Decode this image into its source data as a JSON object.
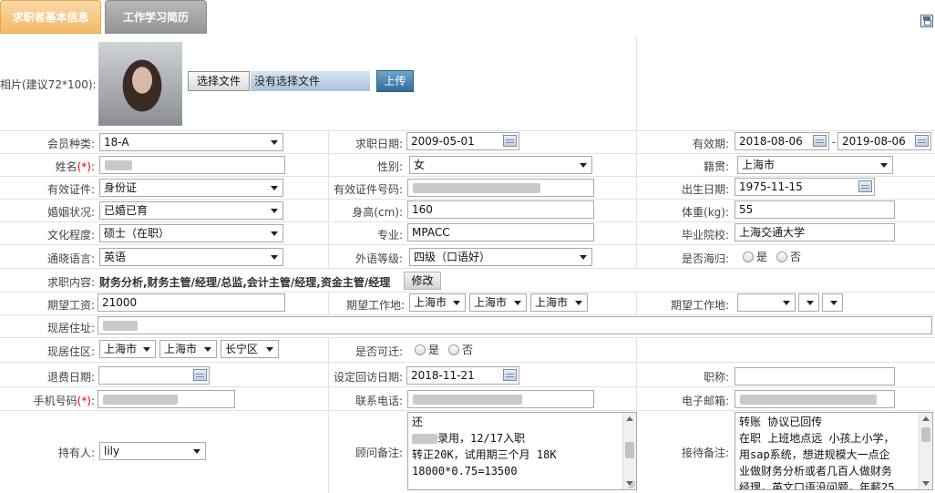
{
  "tabs": [
    {
      "label": "求职者基本信息",
      "active": true
    },
    {
      "label": "工作学习简历",
      "active": false
    }
  ],
  "photo": {
    "label": "相片(建议72*100):",
    "choose_file": "选择文件",
    "no_file": "没有选择文件",
    "upload": "上传"
  },
  "member_type": {
    "label": "会员种类:",
    "value": "18-A"
  },
  "apply_date": {
    "label": "求职日期:",
    "value": "2009-05-01"
  },
  "valid_period": {
    "label": "有效期:",
    "from": "2018-08-06",
    "sep": "-",
    "to": "2019-08-06"
  },
  "name": {
    "label": "姓名",
    "req": "(*)",
    "colon": ":"
  },
  "gender": {
    "label": "性别:",
    "value": "女"
  },
  "native": {
    "label": "籍贯:",
    "value": "上海市"
  },
  "id_type": {
    "label": "有效证件:",
    "value": "身份证"
  },
  "id_number": {
    "label": "有效证件号码:"
  },
  "birth": {
    "label": "出生日期:",
    "value": "1975-11-15"
  },
  "marital": {
    "label": "婚姻状况:",
    "value": "已婚已育"
  },
  "height": {
    "label": "身高(cm):",
    "value": "160"
  },
  "weight": {
    "label": "体重(kg):",
    "value": "55"
  },
  "education": {
    "label": "文化程度:",
    "value": "硕士（在职）"
  },
  "major": {
    "label": "专业:",
    "value": "MPACC"
  },
  "school": {
    "label": "毕业院校:",
    "value": "上海交通大学"
  },
  "language": {
    "label": "通晓语言:",
    "value": "英语"
  },
  "lang_level": {
    "label": "外语等级:",
    "value": "四级（口语好）"
  },
  "returnee": {
    "label": "是否海归:",
    "yes": "是",
    "no": "否"
  },
  "job_content": {
    "label": "求职内容:",
    "value": "财务分析,财务主管/经理/总监,会计主管/经理,资金主管/经理",
    "edit": "修改"
  },
  "salary": {
    "label": "期望工资:",
    "value": "21000"
  },
  "work_place": {
    "label": "期望工作地:",
    "values": [
      "上海市",
      "上海市",
      "上海市"
    ]
  },
  "work_place2": {
    "label": "期望工作地:"
  },
  "address": {
    "label": "现居住址:"
  },
  "residence": {
    "label": "现居住区:",
    "values": [
      "上海市",
      "上海市",
      "长宁区"
    ]
  },
  "relocate": {
    "label": "是否可迁:",
    "yes": "是",
    "no": "否"
  },
  "refund_date": {
    "label": "退费日期:"
  },
  "visit_date": {
    "label": "设定回访日期:",
    "value": "2018-11-21"
  },
  "title": {
    "label": "职称:"
  },
  "mobile": {
    "label": "手机号码",
    "req": "(*)",
    "colon": ":"
  },
  "phone": {
    "label": "联系电话:"
  },
  "email": {
    "label": "电子邮箱:"
  },
  "owner": {
    "label": "持有人:",
    "value": "lily"
  },
  "consultant_note": {
    "label": "顾问备注:",
    "lines": [
      "还",
      "录用，12/17入职",
      "转正20K，试用期三个月 18K",
      "18000*0.75=13500"
    ]
  },
  "reception_note": {
    "label": "接待备注:",
    "lines": [
      "转账  协议已回传",
      "在职 上班地点远 小孩上小学，",
      "用sap系统，想进规模大一点企",
      "业做财务分析或者几百人做财务",
      "经理，英文口语没问题，年薪25"
    ]
  }
}
